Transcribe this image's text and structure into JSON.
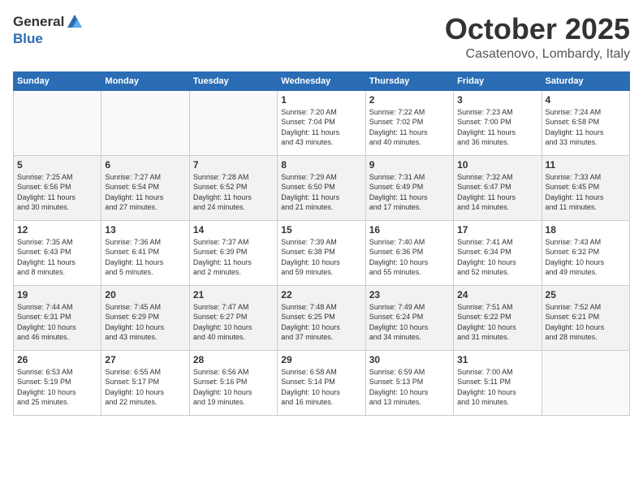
{
  "header": {
    "logo_general": "General",
    "logo_blue": "Blue",
    "month": "October 2025",
    "location": "Casatenovo, Lombardy, Italy"
  },
  "days_of_week": [
    "Sunday",
    "Monday",
    "Tuesday",
    "Wednesday",
    "Thursday",
    "Friday",
    "Saturday"
  ],
  "weeks": [
    [
      {
        "day": "",
        "info": ""
      },
      {
        "day": "",
        "info": ""
      },
      {
        "day": "",
        "info": ""
      },
      {
        "day": "1",
        "info": "Sunrise: 7:20 AM\nSunset: 7:04 PM\nDaylight: 11 hours\nand 43 minutes."
      },
      {
        "day": "2",
        "info": "Sunrise: 7:22 AM\nSunset: 7:02 PM\nDaylight: 11 hours\nand 40 minutes."
      },
      {
        "day": "3",
        "info": "Sunrise: 7:23 AM\nSunset: 7:00 PM\nDaylight: 11 hours\nand 36 minutes."
      },
      {
        "day": "4",
        "info": "Sunrise: 7:24 AM\nSunset: 6:58 PM\nDaylight: 11 hours\nand 33 minutes."
      }
    ],
    [
      {
        "day": "5",
        "info": "Sunrise: 7:25 AM\nSunset: 6:56 PM\nDaylight: 11 hours\nand 30 minutes."
      },
      {
        "day": "6",
        "info": "Sunrise: 7:27 AM\nSunset: 6:54 PM\nDaylight: 11 hours\nand 27 minutes."
      },
      {
        "day": "7",
        "info": "Sunrise: 7:28 AM\nSunset: 6:52 PM\nDaylight: 11 hours\nand 24 minutes."
      },
      {
        "day": "8",
        "info": "Sunrise: 7:29 AM\nSunset: 6:50 PM\nDaylight: 11 hours\nand 21 minutes."
      },
      {
        "day": "9",
        "info": "Sunrise: 7:31 AM\nSunset: 6:49 PM\nDaylight: 11 hours\nand 17 minutes."
      },
      {
        "day": "10",
        "info": "Sunrise: 7:32 AM\nSunset: 6:47 PM\nDaylight: 11 hours\nand 14 minutes."
      },
      {
        "day": "11",
        "info": "Sunrise: 7:33 AM\nSunset: 6:45 PM\nDaylight: 11 hours\nand 11 minutes."
      }
    ],
    [
      {
        "day": "12",
        "info": "Sunrise: 7:35 AM\nSunset: 6:43 PM\nDaylight: 11 hours\nand 8 minutes."
      },
      {
        "day": "13",
        "info": "Sunrise: 7:36 AM\nSunset: 6:41 PM\nDaylight: 11 hours\nand 5 minutes."
      },
      {
        "day": "14",
        "info": "Sunrise: 7:37 AM\nSunset: 6:39 PM\nDaylight: 11 hours\nand 2 minutes."
      },
      {
        "day": "15",
        "info": "Sunrise: 7:39 AM\nSunset: 6:38 PM\nDaylight: 10 hours\nand 59 minutes."
      },
      {
        "day": "16",
        "info": "Sunrise: 7:40 AM\nSunset: 6:36 PM\nDaylight: 10 hours\nand 55 minutes."
      },
      {
        "day": "17",
        "info": "Sunrise: 7:41 AM\nSunset: 6:34 PM\nDaylight: 10 hours\nand 52 minutes."
      },
      {
        "day": "18",
        "info": "Sunrise: 7:43 AM\nSunset: 6:32 PM\nDaylight: 10 hours\nand 49 minutes."
      }
    ],
    [
      {
        "day": "19",
        "info": "Sunrise: 7:44 AM\nSunset: 6:31 PM\nDaylight: 10 hours\nand 46 minutes."
      },
      {
        "day": "20",
        "info": "Sunrise: 7:45 AM\nSunset: 6:29 PM\nDaylight: 10 hours\nand 43 minutes."
      },
      {
        "day": "21",
        "info": "Sunrise: 7:47 AM\nSunset: 6:27 PM\nDaylight: 10 hours\nand 40 minutes."
      },
      {
        "day": "22",
        "info": "Sunrise: 7:48 AM\nSunset: 6:25 PM\nDaylight: 10 hours\nand 37 minutes."
      },
      {
        "day": "23",
        "info": "Sunrise: 7:49 AM\nSunset: 6:24 PM\nDaylight: 10 hours\nand 34 minutes."
      },
      {
        "day": "24",
        "info": "Sunrise: 7:51 AM\nSunset: 6:22 PM\nDaylight: 10 hours\nand 31 minutes."
      },
      {
        "day": "25",
        "info": "Sunrise: 7:52 AM\nSunset: 6:21 PM\nDaylight: 10 hours\nand 28 minutes."
      }
    ],
    [
      {
        "day": "26",
        "info": "Sunrise: 6:53 AM\nSunset: 5:19 PM\nDaylight: 10 hours\nand 25 minutes."
      },
      {
        "day": "27",
        "info": "Sunrise: 6:55 AM\nSunset: 5:17 PM\nDaylight: 10 hours\nand 22 minutes."
      },
      {
        "day": "28",
        "info": "Sunrise: 6:56 AM\nSunset: 5:16 PM\nDaylight: 10 hours\nand 19 minutes."
      },
      {
        "day": "29",
        "info": "Sunrise: 6:58 AM\nSunset: 5:14 PM\nDaylight: 10 hours\nand 16 minutes."
      },
      {
        "day": "30",
        "info": "Sunrise: 6:59 AM\nSunset: 5:13 PM\nDaylight: 10 hours\nand 13 minutes."
      },
      {
        "day": "31",
        "info": "Sunrise: 7:00 AM\nSunset: 5:11 PM\nDaylight: 10 hours\nand 10 minutes."
      },
      {
        "day": "",
        "info": ""
      }
    ]
  ]
}
